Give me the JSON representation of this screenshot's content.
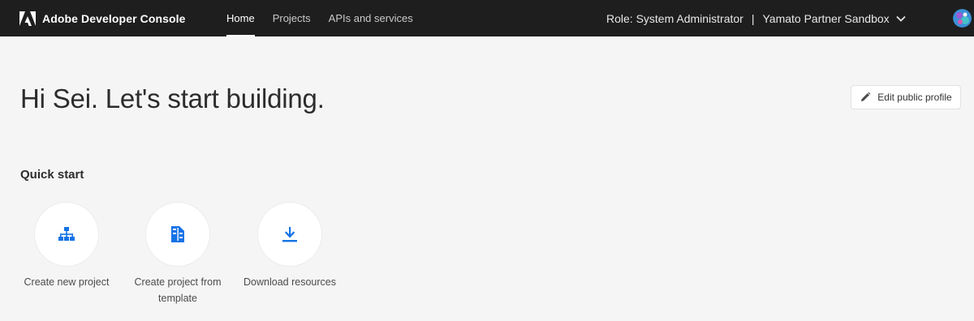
{
  "header": {
    "brand": "Adobe Developer Console",
    "nav": [
      {
        "label": "Home",
        "active": true
      },
      {
        "label": "Projects",
        "active": false
      },
      {
        "label": "APIs and services",
        "active": false
      }
    ],
    "role": "Role: System Administrator",
    "separator": "|",
    "org": "Yamato Partner Sandbox"
  },
  "main": {
    "greeting": "Hi Sei. Let's start building.",
    "edit_profile_label": "Edit public profile",
    "quick_start_title": "Quick start",
    "quick_start": [
      {
        "label": "Create new project",
        "icon": "hierarchy-icon"
      },
      {
        "label": "Create project from template",
        "icon": "template-icon"
      },
      {
        "label": "Download resources",
        "icon": "download-icon"
      }
    ]
  },
  "colors": {
    "topbar": "#1e1e1e",
    "accent_blue": "#1473e6",
    "background": "#f5f5f5"
  }
}
